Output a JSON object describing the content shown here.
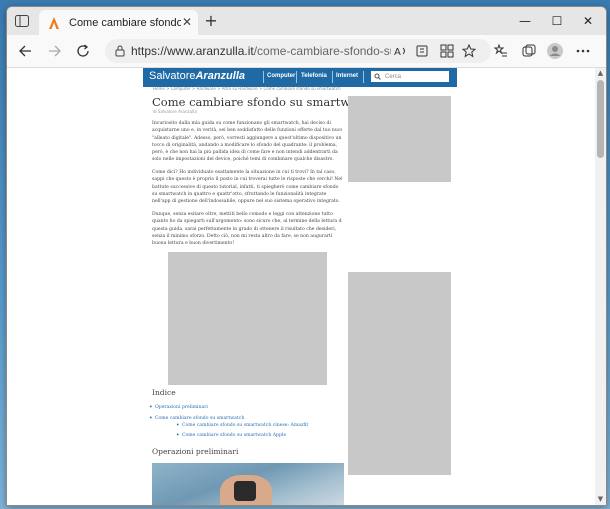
{
  "browser": {
    "tab_title": "Come cambiare sfondo su smartw",
    "tab_close": "✕",
    "new_tab": "+",
    "url_prefix": "https://www.aranzulla.it",
    "url_path": "/come-cambiare-sfondo-su-smartwatch",
    "window_buttons": {
      "minimize": "—",
      "maximize": "☐",
      "close": "✕"
    }
  },
  "site": {
    "logo_light": "Salvatore",
    "logo_bold": "Aranzulla",
    "nav": [
      "Computer",
      "Telefonia",
      "Internet"
    ],
    "search_placeholder": "Cerca",
    "breadcrumb": "Home > Computer > Hardware > Altro su Hardware > Come cambiare sfondo su smartwatch",
    "title": "Come cambiare sfondo su smartwatch",
    "byline": "di Salvatore Aranzulla",
    "p1": [
      "Incuriosito dalla mia guida su come funzionano gli smartwatch, hai deciso di",
      "acquistarne uno e, in verità, sei ben soddisfatto delle funzioni offerte dal tuo nuovo",
      "\"alleato digitale\". Adesso, però, vorresti aggiungere a quest'ultimo dispositivo un",
      "tocco di originalità, andando a modificare lo sfondo del quadrante: il problema,",
      "però, è che non hai la più pallida idea di come fare e non intendi addentrarti da",
      "solo nelle impostazioni del device, poiché temi di combinare qualche disastro."
    ],
    "p2": [
      "Come dici? Ho individuato esattamente la situazione in cui ti trovi? In tal caso,",
      "sappi che questo è proprio il posto in cui troverai tutte le risposte che cerchi! Nelle",
      "battute successive di questo tutorial, infatti, ti spiegherò come cambiare sfondo",
      "su smartwatch in quattro e quattr'otto, sfruttando le funzionalità integrate",
      "nell'app di gestione dell'indossabile, oppure nel suo sistema operativo integrato."
    ],
    "p3": [
      "Dunque, senza esitare oltre, mettiti bello comodo e leggi con attenzione tutto",
      "quanto ho da spiegarti sull'argomento: sono sicuro che, al termine della lettura di",
      "questa guida, sarai perfettamente in grado di ottenere il risultato che desideri,",
      "senza il minimo sforzo. Detto ciò, non mi resta altro da fare, se non augurarti",
      "buona lettura e buon divertimento!"
    ],
    "toc_heading": "Indice",
    "toc": [
      "Operazioni preliminari",
      "Come cambiare sfondo su smartwatch",
      "Come cambiare sfondo su smartwatch cinese: Amazfit",
      "Come cambiare sfondo su smartwatch Apple"
    ],
    "section_heading": "Operazioni preliminari"
  },
  "colors": {
    "header_blue": "#1f6aa5",
    "link": "#2a6fb5",
    "ad_gray": "#c8c8c8"
  },
  "icons": {
    "back": "arrow-left-icon",
    "forward": "arrow-right-icon",
    "refresh": "refresh-icon",
    "lock": "lock-icon",
    "read_aloud": "read-aloud-icon",
    "tab_actions": "tab-actions-icon"
  }
}
